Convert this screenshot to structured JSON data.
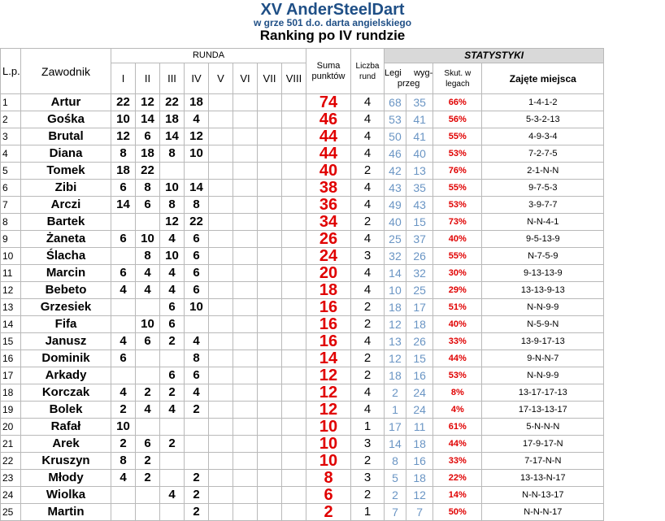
{
  "title": {
    "main": "XV AnderSteelDart",
    "sub": "w grze 501 d.o. darta angielskiego",
    "ranking": "Ranking po IV rundzie"
  },
  "headers": {
    "lp": "L.p.",
    "player": "Zawodnik",
    "runda": "RUNDA",
    "rounds": [
      "I",
      "II",
      "III",
      "IV",
      "V",
      "VI",
      "VII",
      "VIII"
    ],
    "suma_line1": "Suma",
    "suma_line2": "punktów",
    "liczba_line1": "Liczba",
    "liczba_line2": "rund",
    "statystyki": "STATYSTYKI",
    "legi": "Legi",
    "wyg": "wyg-",
    "przeg": "przeg",
    "skut_line1": "Skut. w",
    "skut_line2": "legach",
    "zajete": "Zajęte miejsca"
  },
  "rows": [
    {
      "lp": "1",
      "name": "Artur",
      "r": [
        "22",
        "12",
        "22",
        "18",
        "",
        "",
        "",
        ""
      ],
      "sum": "74",
      "cnt": "4",
      "won": "68",
      "lost": "35",
      "pct": "66%",
      "places": "1-4-1-2"
    },
    {
      "lp": "2",
      "name": "Gośka",
      "r": [
        "10",
        "14",
        "18",
        "4",
        "",
        "",
        "",
        ""
      ],
      "sum": "46",
      "cnt": "4",
      "won": "53",
      "lost": "41",
      "pct": "56%",
      "places": "5-3-2-13"
    },
    {
      "lp": "3",
      "name": "Brutal",
      "r": [
        "12",
        "6",
        "14",
        "12",
        "",
        "",
        "",
        ""
      ],
      "sum": "44",
      "cnt": "4",
      "won": "50",
      "lost": "41",
      "pct": "55%",
      "places": "4-9-3-4"
    },
    {
      "lp": "4",
      "name": "Diana",
      "r": [
        "8",
        "18",
        "8",
        "10",
        "",
        "",
        "",
        ""
      ],
      "sum": "44",
      "cnt": "4",
      "won": "46",
      "lost": "40",
      "pct": "53%",
      "places": "7-2-7-5"
    },
    {
      "lp": "5",
      "name": "Tomek",
      "r": [
        "18",
        "22",
        "",
        "",
        "",
        "",
        "",
        ""
      ],
      "sum": "40",
      "cnt": "2",
      "won": "42",
      "lost": "13",
      "pct": "76%",
      "places": "2-1-N-N"
    },
    {
      "lp": "6",
      "name": "Zibi",
      "r": [
        "6",
        "8",
        "10",
        "14",
        "",
        "",
        "",
        ""
      ],
      "sum": "38",
      "cnt": "4",
      "won": "43",
      "lost": "35",
      "pct": "55%",
      "places": "9-7-5-3"
    },
    {
      "lp": "7",
      "name": "Arczi",
      "r": [
        "14",
        "6",
        "8",
        "8",
        "",
        "",
        "",
        ""
      ],
      "sum": "36",
      "cnt": "4",
      "won": "49",
      "lost": "43",
      "pct": "53%",
      "places": "3-9-7-7"
    },
    {
      "lp": "8",
      "name": "Bartek",
      "r": [
        "",
        "",
        "12",
        "22",
        "",
        "",
        "",
        ""
      ],
      "sum": "34",
      "cnt": "2",
      "won": "40",
      "lost": "15",
      "pct": "73%",
      "places": "N-N-4-1"
    },
    {
      "lp": "9",
      "name": "Żaneta",
      "r": [
        "6",
        "10",
        "4",
        "6",
        "",
        "",
        "",
        ""
      ],
      "sum": "26",
      "cnt": "4",
      "won": "25",
      "lost": "37",
      "pct": "40%",
      "places": "9-5-13-9"
    },
    {
      "lp": "10",
      "name": "Ślacha",
      "r": [
        "",
        "8",
        "10",
        "6",
        "",
        "",
        "",
        ""
      ],
      "sum": "24",
      "cnt": "3",
      "won": "32",
      "lost": "26",
      "pct": "55%",
      "places": "N-7-5-9"
    },
    {
      "lp": "11",
      "name": "Marcin",
      "r": [
        "6",
        "4",
        "4",
        "6",
        "",
        "",
        "",
        ""
      ],
      "sum": "20",
      "cnt": "4",
      "won": "14",
      "lost": "32",
      "pct": "30%",
      "places": "9-13-13-9"
    },
    {
      "lp": "12",
      "name": "Bebeto",
      "r": [
        "4",
        "4",
        "4",
        "6",
        "",
        "",
        "",
        ""
      ],
      "sum": "18",
      "cnt": "4",
      "won": "10",
      "lost": "25",
      "pct": "29%",
      "places": "13-13-9-13"
    },
    {
      "lp": "13",
      "name": "Grzesiek",
      "r": [
        "",
        "",
        "6",
        "10",
        "",
        "",
        "",
        ""
      ],
      "sum": "16",
      "cnt": "2",
      "won": "18",
      "lost": "17",
      "pct": "51%",
      "places": "N-N-9-9"
    },
    {
      "lp": "14",
      "name": "Fifa",
      "r": [
        "",
        "10",
        "6",
        "",
        "",
        "",
        "",
        ""
      ],
      "sum": "16",
      "cnt": "2",
      "won": "12",
      "lost": "18",
      "pct": "40%",
      "places": "N-5-9-N"
    },
    {
      "lp": "15",
      "name": "Janusz",
      "r": [
        "4",
        "6",
        "2",
        "4",
        "",
        "",
        "",
        ""
      ],
      "sum": "16",
      "cnt": "4",
      "won": "13",
      "lost": "26",
      "pct": "33%",
      "places": "13-9-17-13"
    },
    {
      "lp": "16",
      "name": "Dominik",
      "r": [
        "6",
        "",
        "",
        "8",
        "",
        "",
        "",
        ""
      ],
      "sum": "14",
      "cnt": "2",
      "won": "12",
      "lost": "15",
      "pct": "44%",
      "places": "9-N-N-7"
    },
    {
      "lp": "17",
      "name": "Arkady",
      "r": [
        "",
        "",
        "6",
        "6",
        "",
        "",
        "",
        ""
      ],
      "sum": "12",
      "cnt": "2",
      "won": "18",
      "lost": "16",
      "pct": "53%",
      "places": "N-N-9-9"
    },
    {
      "lp": "18",
      "name": "Korczak",
      "r": [
        "4",
        "2",
        "2",
        "4",
        "",
        "",
        "",
        ""
      ],
      "sum": "12",
      "cnt": "4",
      "won": "2",
      "lost": "24",
      "pct": "8%",
      "places": "13-17-17-13"
    },
    {
      "lp": "19",
      "name": "Bolek",
      "r": [
        "2",
        "4",
        "4",
        "2",
        "",
        "",
        "",
        ""
      ],
      "sum": "12",
      "cnt": "4",
      "won": "1",
      "lost": "24",
      "pct": "4%",
      "places": "17-13-13-17"
    },
    {
      "lp": "20",
      "name": "Rafał",
      "r": [
        "10",
        "",
        "",
        "",
        "",
        "",
        "",
        ""
      ],
      "sum": "10",
      "cnt": "1",
      "won": "17",
      "lost": "11",
      "pct": "61%",
      "places": "5-N-N-N"
    },
    {
      "lp": "21",
      "name": "Arek",
      "r": [
        "2",
        "6",
        "2",
        "",
        "",
        "",
        "",
        ""
      ],
      "sum": "10",
      "cnt": "3",
      "won": "14",
      "lost": "18",
      "pct": "44%",
      "places": "17-9-17-N"
    },
    {
      "lp": "22",
      "name": "Kruszyn",
      "r": [
        "8",
        "2",
        "",
        "",
        "",
        "",
        "",
        ""
      ],
      "sum": "10",
      "cnt": "2",
      "won": "8",
      "lost": "16",
      "pct": "33%",
      "places": "7-17-N-N"
    },
    {
      "lp": "23",
      "name": "Młody",
      "r": [
        "4",
        "2",
        "",
        "2",
        "",
        "",
        "",
        ""
      ],
      "sum": "8",
      "cnt": "3",
      "won": "5",
      "lost": "18",
      "pct": "22%",
      "places": "13-13-N-17"
    },
    {
      "lp": "24",
      "name": "Wiolka",
      "r": [
        "",
        "",
        "4",
        "2",
        "",
        "",
        "",
        ""
      ],
      "sum": "6",
      "cnt": "2",
      "won": "2",
      "lost": "12",
      "pct": "14%",
      "places": "N-N-13-17"
    },
    {
      "lp": "25",
      "name": "Martin",
      "r": [
        "",
        "",
        "",
        "2",
        "",
        "",
        "",
        ""
      ],
      "sum": "2",
      "cnt": "1",
      "won": "7",
      "lost": "7",
      "pct": "50%",
      "places": "N-N-N-17"
    }
  ]
}
